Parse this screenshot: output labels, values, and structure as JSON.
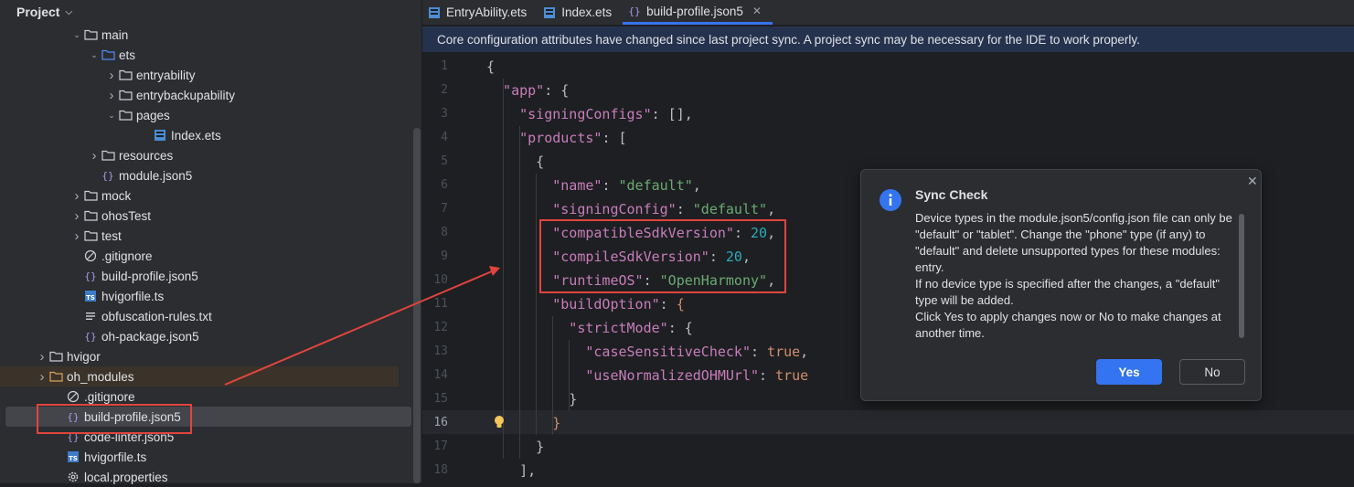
{
  "project_panel": {
    "title": "Project",
    "tree": [
      {
        "label": "main",
        "indent": 3,
        "arrow": "down",
        "icon": "folder"
      },
      {
        "label": "ets",
        "indent": 4,
        "arrow": "down",
        "icon": "folder-blue"
      },
      {
        "label": "entryability",
        "indent": 5,
        "arrow": "right",
        "icon": "folder"
      },
      {
        "label": "entrybackupability",
        "indent": 5,
        "arrow": "right",
        "icon": "folder"
      },
      {
        "label": "pages",
        "indent": 5,
        "arrow": "down",
        "icon": "folder"
      },
      {
        "label": "Index.ets",
        "indent": 7,
        "arrow": "",
        "icon": "ets"
      },
      {
        "label": "resources",
        "indent": 4,
        "arrow": "right",
        "icon": "folder"
      },
      {
        "label": "module.json5",
        "indent": 4,
        "arrow": "",
        "icon": "json"
      },
      {
        "label": "mock",
        "indent": 3,
        "arrow": "right",
        "icon": "folder"
      },
      {
        "label": "ohosTest",
        "indent": 3,
        "arrow": "right",
        "icon": "folder"
      },
      {
        "label": "test",
        "indent": 3,
        "arrow": "right",
        "icon": "folder"
      },
      {
        "label": ".gitignore",
        "indent": 3,
        "arrow": "",
        "icon": "gitignore"
      },
      {
        "label": "build-profile.json5",
        "indent": 3,
        "arrow": "",
        "icon": "json"
      },
      {
        "label": "hvigorfile.ts",
        "indent": 3,
        "arrow": "",
        "icon": "ts"
      },
      {
        "label": "obfuscation-rules.txt",
        "indent": 3,
        "arrow": "",
        "icon": "txt"
      },
      {
        "label": "oh-package.json5",
        "indent": 3,
        "arrow": "",
        "icon": "json"
      },
      {
        "label": "hvigor",
        "indent": 1,
        "arrow": "right",
        "icon": "folder"
      },
      {
        "label": "oh_modules",
        "indent": 1,
        "arrow": "right",
        "icon": "folder-orange"
      },
      {
        "label": ".gitignore",
        "indent": 2,
        "arrow": "",
        "icon": "gitignore"
      },
      {
        "label": "build-profile.json5",
        "indent": 2,
        "arrow": "",
        "icon": "json"
      },
      {
        "label": "code-linter.json5",
        "indent": 2,
        "arrow": "",
        "icon": "json"
      },
      {
        "label": "hvigorfile.ts",
        "indent": 2,
        "arrow": "",
        "icon": "ts"
      },
      {
        "label": "local.properties",
        "indent": 2,
        "arrow": "",
        "icon": "gear"
      }
    ]
  },
  "tabs": [
    {
      "label": "EntryAbility.ets",
      "icon": "ets"
    },
    {
      "label": "Index.ets",
      "icon": "ets"
    },
    {
      "label": "build-profile.json5",
      "icon": "json",
      "active": true
    }
  ],
  "banner": "Core configuration attributes have changed since last project sync. A project sync may be necessary for the IDE to work properly.",
  "editor": {
    "current_line": 16,
    "lines": [
      {
        "num": "1",
        "tokens": [
          {
            "t": "{",
            "c": "p"
          }
        ]
      },
      {
        "num": "2",
        "tokens": [
          {
            "t": "  \"app\"",
            "c": "k"
          },
          {
            "t": ": {",
            "c": "p"
          }
        ]
      },
      {
        "num": "3",
        "tokens": [
          {
            "t": "    \"signingConfigs\"",
            "c": "k"
          },
          {
            "t": ": [],",
            "c": "p"
          }
        ]
      },
      {
        "num": "4",
        "tokens": [
          {
            "t": "    \"products\"",
            "c": "k"
          },
          {
            "t": ": [",
            "c": "p"
          }
        ]
      },
      {
        "num": "5",
        "tokens": [
          {
            "t": "      {",
            "c": "p"
          }
        ]
      },
      {
        "num": "6",
        "tokens": [
          {
            "t": "        \"name\"",
            "c": "k"
          },
          {
            "t": ": ",
            "c": "p"
          },
          {
            "t": "\"default\"",
            "c": "s"
          },
          {
            "t": ",",
            "c": "p"
          }
        ]
      },
      {
        "num": "7",
        "tokens": [
          {
            "t": "        \"signingConfig\"",
            "c": "k"
          },
          {
            "t": ": ",
            "c": "p"
          },
          {
            "t": "\"default\"",
            "c": "s"
          },
          {
            "t": ",",
            "c": "p"
          }
        ]
      },
      {
        "num": "8",
        "tokens": [
          {
            "t": "        \"compatibleSdkVersion\"",
            "c": "k"
          },
          {
            "t": ": ",
            "c": "p"
          },
          {
            "t": "20",
            "c": "n"
          },
          {
            "t": ",",
            "c": "p"
          }
        ]
      },
      {
        "num": "9",
        "tokens": [
          {
            "t": "        \"compileSdkVersion\"",
            "c": "k"
          },
          {
            "t": ": ",
            "c": "p"
          },
          {
            "t": "20",
            "c": "n"
          },
          {
            "t": ",",
            "c": "p"
          }
        ]
      },
      {
        "num": "10",
        "tokens": [
          {
            "t": "        \"runtimeOS\"",
            "c": "k"
          },
          {
            "t": ": ",
            "c": "p"
          },
          {
            "t": "\"OpenHarmony\"",
            "c": "s"
          },
          {
            "t": ",",
            "c": "p"
          }
        ]
      },
      {
        "num": "11",
        "tokens": [
          {
            "t": "        \"buildOption\"",
            "c": "k"
          },
          {
            "t": ": ",
            "c": "p"
          },
          {
            "t": "{",
            "c": "b"
          }
        ]
      },
      {
        "num": "12",
        "tokens": [
          {
            "t": "          \"strictMode\"",
            "c": "k"
          },
          {
            "t": ": {",
            "c": "p"
          }
        ]
      },
      {
        "num": "13",
        "tokens": [
          {
            "t": "            \"caseSensitiveCheck\"",
            "c": "k"
          },
          {
            "t": ": ",
            "c": "p"
          },
          {
            "t": "true",
            "c": "b"
          },
          {
            "t": ",",
            "c": "p"
          }
        ]
      },
      {
        "num": "14",
        "tokens": [
          {
            "t": "            \"useNormalizedOHMUrl\"",
            "c": "k"
          },
          {
            "t": ": ",
            "c": "p"
          },
          {
            "t": "true",
            "c": "b"
          }
        ]
      },
      {
        "num": "15",
        "tokens": [
          {
            "t": "          }",
            "c": "p"
          }
        ]
      },
      {
        "num": "16",
        "tokens": [
          {
            "t": "        }",
            "c": "b"
          }
        ]
      },
      {
        "num": "17",
        "tokens": [
          {
            "t": "      }",
            "c": "p"
          }
        ]
      },
      {
        "num": "18",
        "tokens": [
          {
            "t": "    ],",
            "c": "p"
          }
        ]
      }
    ]
  },
  "dialog": {
    "title": "Sync Check",
    "message": [
      "Device types in the module.json5/config.json file can only be \"default\" or \"tablet\". Change the \"phone\" type (if any) to \"default\" and delete unsupported types for these modules: entry.",
      "If no device type is specified after the changes, a \"default\" type will be added.",
      "Click Yes to apply changes now or No to make changes at another time."
    ],
    "yes_label": "Yes",
    "no_label": "No"
  },
  "colors": {
    "accent": "#3574f0",
    "annotation": "#e0443e"
  }
}
